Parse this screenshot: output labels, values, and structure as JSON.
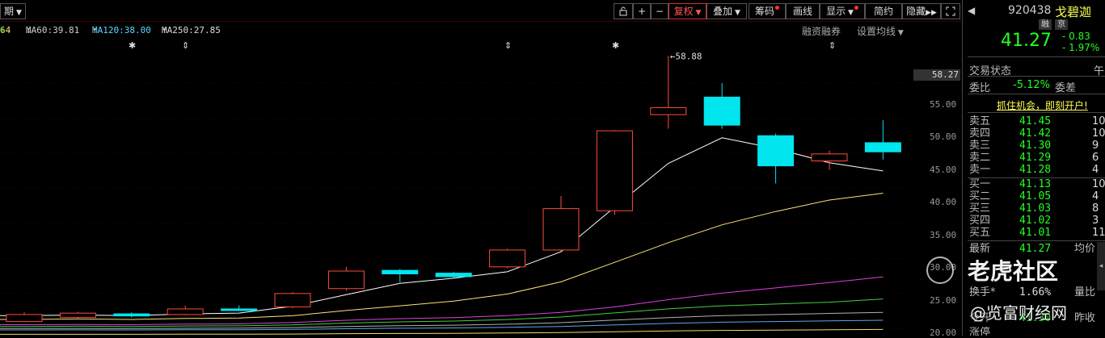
{
  "toolbar": {
    "period_label": "期",
    "buttons": [
      "复权",
      "叠加",
      "筹码",
      "画线",
      "显示",
      "简约",
      "隐藏"
    ],
    "active_button": "复权"
  },
  "ma_legend": {
    "ma_first_value": "64",
    "ma60": "MA60:39.81",
    "ma120": "MA120:38.00",
    "ma250": "MA250:27.85",
    "link_margin": "融资融券",
    "link_settings": "设置均线"
  },
  "price_axis": {
    "ticks": [
      "55.00",
      "50.00",
      "45.00",
      "40.00",
      "35.00",
      "30.00",
      "25.00",
      "20.00"
    ],
    "current_tag": "58.27"
  },
  "chart_data": {
    "type": "candlestick",
    "candles": [
      {
        "open": 21.0,
        "close": 22.0,
        "high": 22.3,
        "low": 20.9
      },
      {
        "open": 21.6,
        "close": 22.2,
        "high": 22.4,
        "low": 21.4
      },
      {
        "open": 22.1,
        "close": 21.8,
        "high": 22.3,
        "low": 21.6
      },
      {
        "open": 22.0,
        "close": 22.8,
        "high": 23.3,
        "low": 21.9
      },
      {
        "open": 22.8,
        "close": 22.6,
        "high": 23.3,
        "low": 22.5
      },
      {
        "open": 23.1,
        "close": 25.0,
        "high": 25.2,
        "low": 22.9
      },
      {
        "open": 25.7,
        "close": 28.2,
        "high": 28.8,
        "low": 25.4
      },
      {
        "open": 28.3,
        "close": 27.8,
        "high": 28.5,
        "low": 26.6
      },
      {
        "open": 27.9,
        "close": 27.4,
        "high": 28.1,
        "low": 27.2
      },
      {
        "open": 28.8,
        "close": 31.2,
        "high": 31.4,
        "low": 28.6
      },
      {
        "open": 31.2,
        "close": 37.1,
        "high": 38.9,
        "low": 31.0
      },
      {
        "open": 36.8,
        "close": 48.2,
        "high": 48.3,
        "low": 36.2
      },
      {
        "open": 50.5,
        "close": 51.5,
        "high": 58.88,
        "low": 48.5
      },
      {
        "open": 53.0,
        "close": 49.0,
        "high": 55.0,
        "low": 48.5
      },
      {
        "open": 47.5,
        "close": 43.2,
        "high": 47.8,
        "low": 40.7
      },
      {
        "open": 43.9,
        "close": 44.9,
        "high": 45.4,
        "low": 42.6
      },
      {
        "open": 46.5,
        "close": 45.2,
        "high": 49.7,
        "low": 44.1
      }
    ],
    "peak_annotation": "58.88",
    "ylim": [
      19.0,
      59.6
    ]
  },
  "panel": {
    "code": "920438",
    "name": "戈碧迦",
    "badge_rong": "融",
    "badge_jing": "京",
    "price": "41.27",
    "change": "- 0.83",
    "change_pct": "- 1.97%",
    "trade_status_label": "交易状态",
    "trade_status_value": "午",
    "weibi_label": "委比",
    "weibi_value": "-5.12%",
    "weicha_label": "委差",
    "promo": "抓住机会，即刻开户!",
    "asks": [
      {
        "label": "卖五",
        "price": "41.45",
        "vol": "10"
      },
      {
        "label": "卖四",
        "price": "41.42",
        "vol": "10"
      },
      {
        "label": "卖三",
        "price": "41.30",
        "vol": "9"
      },
      {
        "label": "卖二",
        "price": "41.29",
        "vol": "6"
      },
      {
        "label": "卖一",
        "price": "41.28",
        "vol": "4"
      }
    ],
    "bids": [
      {
        "label": "买一",
        "price": "41.13",
        "vol": "10"
      },
      {
        "label": "买二",
        "price": "41.05",
        "vol": "4"
      },
      {
        "label": "买三",
        "price": "41.03",
        "vol": "8"
      },
      {
        "label": "买四",
        "price": "41.02",
        "vol": "3"
      },
      {
        "label": "买五",
        "price": "41.01",
        "vol": "11"
      }
    ],
    "latest_label": "最新",
    "latest_value": "41.27",
    "avg_label": "均价",
    "turnover_label": "换手*",
    "turnover_value": "1.66%",
    "vol_ratio_label": "量比",
    "open_label": "今开",
    "open_value": "41.30",
    "prev_close_label": "昨收",
    "limit_up_label": "涨停"
  },
  "watermark": {
    "line1": "老虎社区",
    "line2": "@览富财经网"
  },
  "colors": {
    "up": "#ff4b3a",
    "down": "#00e5ee",
    "ma_white": "#ffffff",
    "ma_yellow": "#ffe27a",
    "ma_magenta": "#e040e0",
    "ma_green": "#40d040",
    "ma_gray": "#b0b0b0",
    "ma_blue": "#5aa8e8",
    "ma_yellow2": "#e8e060"
  }
}
